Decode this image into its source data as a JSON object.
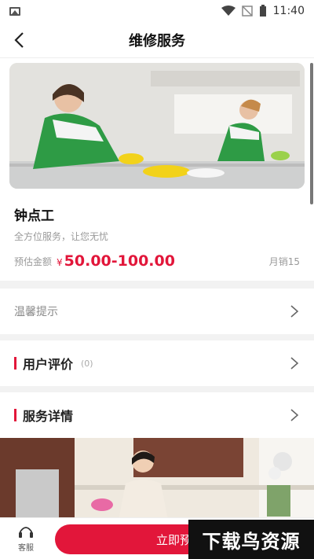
{
  "status_bar": {
    "time": "11:40"
  },
  "nav": {
    "title": "维修服务",
    "back_icon": "back-arrow-icon"
  },
  "product": {
    "name": "钟点工",
    "subtitle": "全方位服务，让您无忧",
    "price_label": "预估金额",
    "currency": "¥",
    "price": "50.00-100.00",
    "sales": "月销15"
  },
  "tips": {
    "label": "温馨提示"
  },
  "reviews": {
    "label": "用户评价",
    "count": "(0)"
  },
  "details": {
    "label": "服务详情"
  },
  "bottom": {
    "service_label": "客服",
    "book_label": "立即预约"
  },
  "watermark": "下载鸟资源",
  "colors": {
    "accent": "#e2163a"
  }
}
